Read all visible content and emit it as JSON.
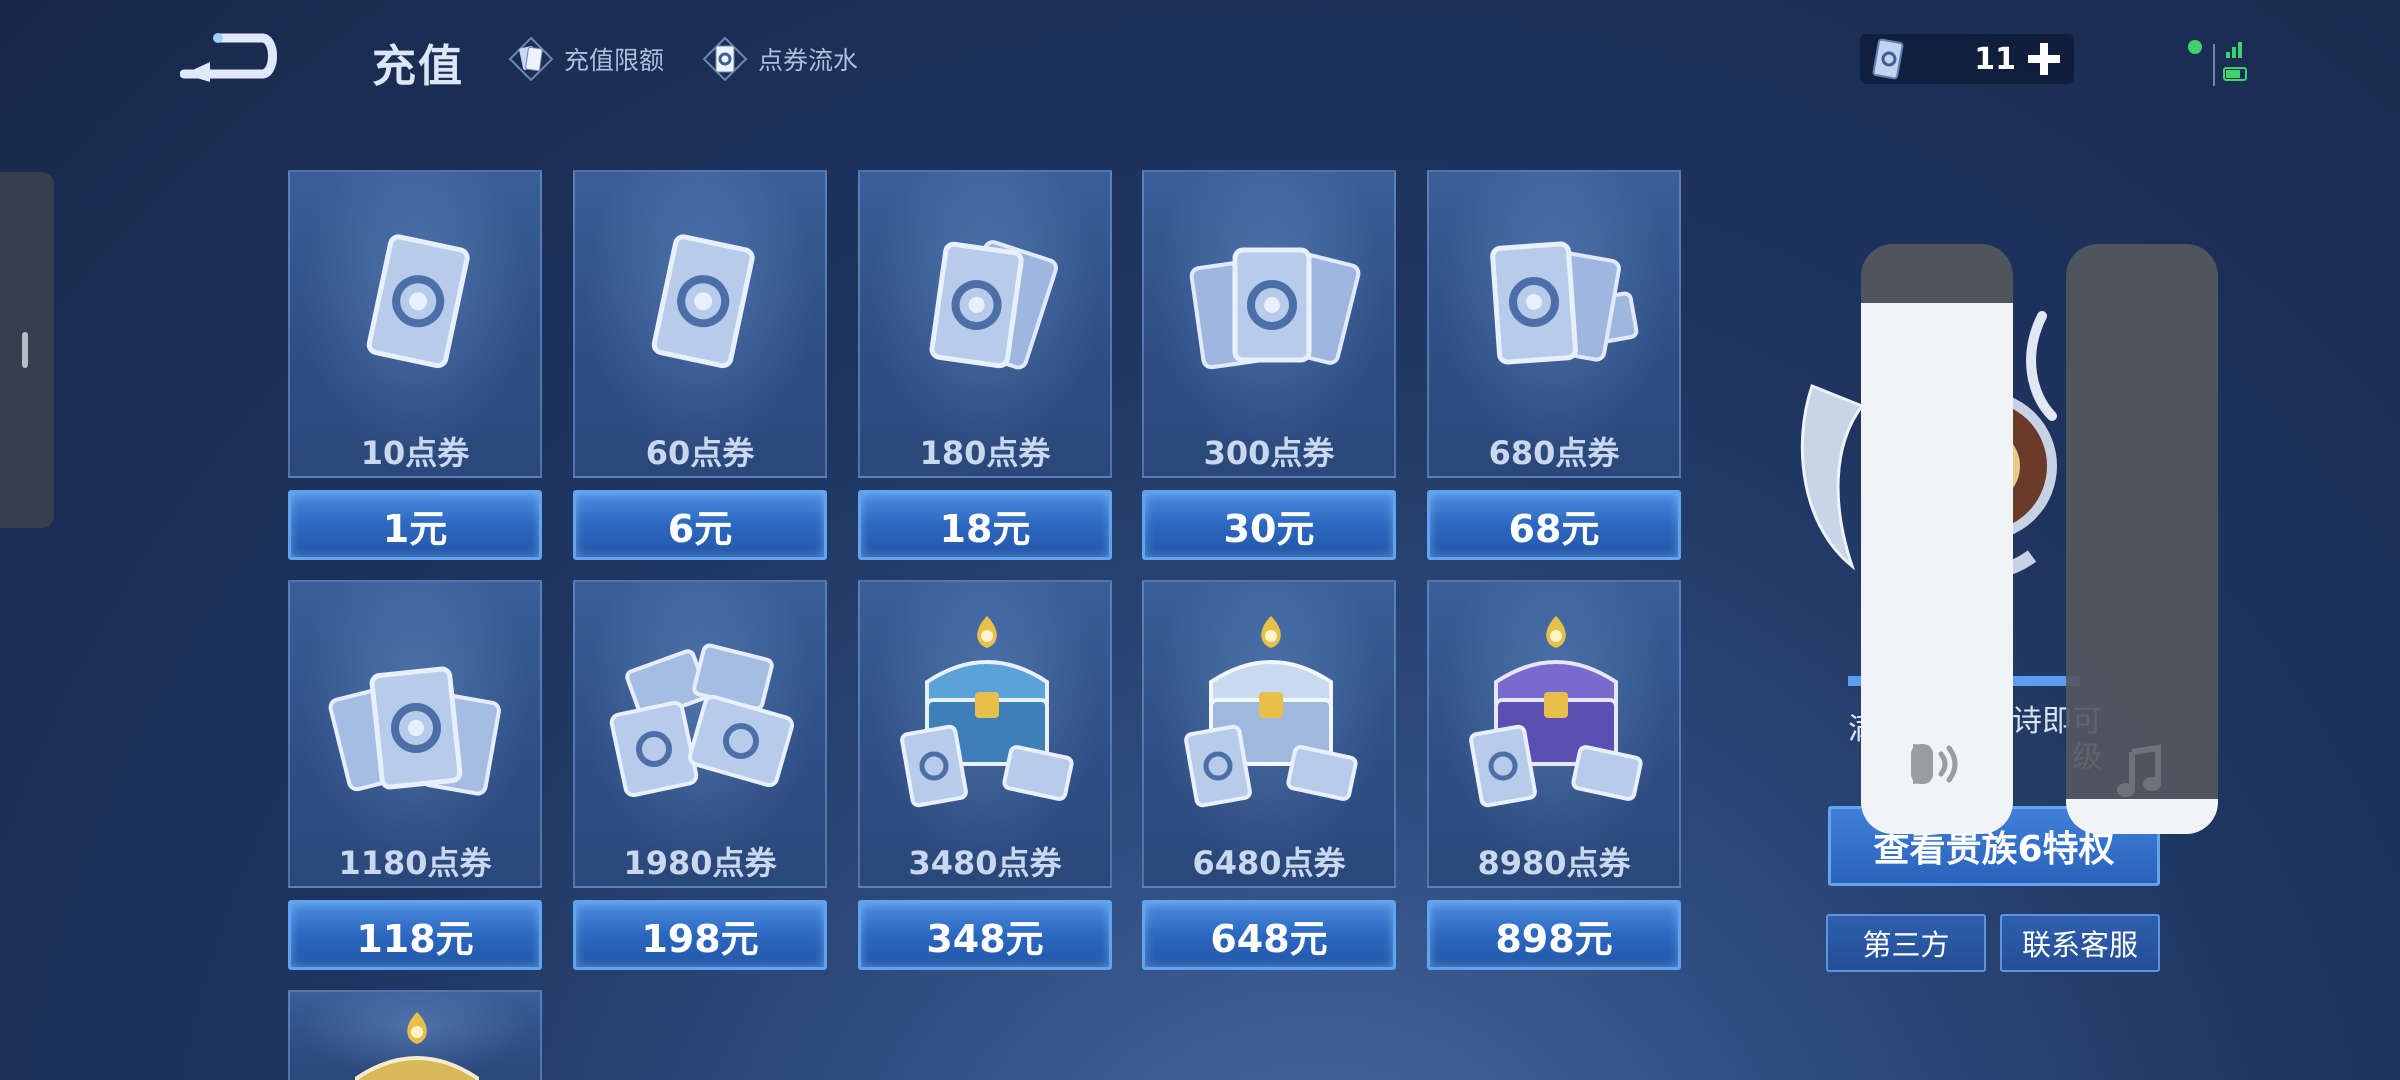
{
  "header": {
    "title": "充值",
    "tabs": [
      {
        "label": "充值限额",
        "icon": "card-icon"
      },
      {
        "label": "点券流水",
        "icon": "voucher-flow-icon"
      }
    ],
    "balance": {
      "value": "11",
      "icon": "voucher-card-icon",
      "add_icon": "plus-icon"
    },
    "status": {
      "wifi_icon": "signal-icon",
      "dot_color": "#3fd16b"
    }
  },
  "products": [
    {
      "amount": "10点券",
      "price": "1元",
      "art": "single-card"
    },
    {
      "amount": "60点券",
      "price": "6元",
      "art": "single-card"
    },
    {
      "amount": "180点券",
      "price": "18元",
      "art": "two-cards"
    },
    {
      "amount": "300点券",
      "price": "30元",
      "art": "three-cards"
    },
    {
      "amount": "680点券",
      "price": "68元",
      "art": "card-stack"
    },
    {
      "amount": "1180点券",
      "price": "118元",
      "art": "card-pile"
    },
    {
      "amount": "1980点券",
      "price": "198元",
      "art": "card-heap"
    },
    {
      "amount": "3480点券",
      "price": "348元",
      "art": "chest-blue"
    },
    {
      "amount": "6480点券",
      "price": "648元",
      "art": "chest-silver"
    },
    {
      "amount": "8980点券",
      "price": "898元",
      "art": "chest-purple"
    },
    {
      "amount": "",
      "price": "",
      "art": "chest-gold"
    }
  ],
  "noble": {
    "progress": 1.0,
    "hint_left": "满",
    "hint_right_line1": "诗即可",
    "hint_right_line2": "级",
    "view_button": "查看贵族6特权",
    "third_party": "第三方",
    "contact": "联系客服"
  },
  "overlay": {
    "volume_level": 0.9,
    "music_level": 0.06,
    "volume_icon": "speaker-icon",
    "music_icon": "music-note-icon"
  },
  "colors": {
    "price_button": "#2c67bf",
    "card_bg": "#2f4f86",
    "accent_gold": "#e6c04a"
  }
}
